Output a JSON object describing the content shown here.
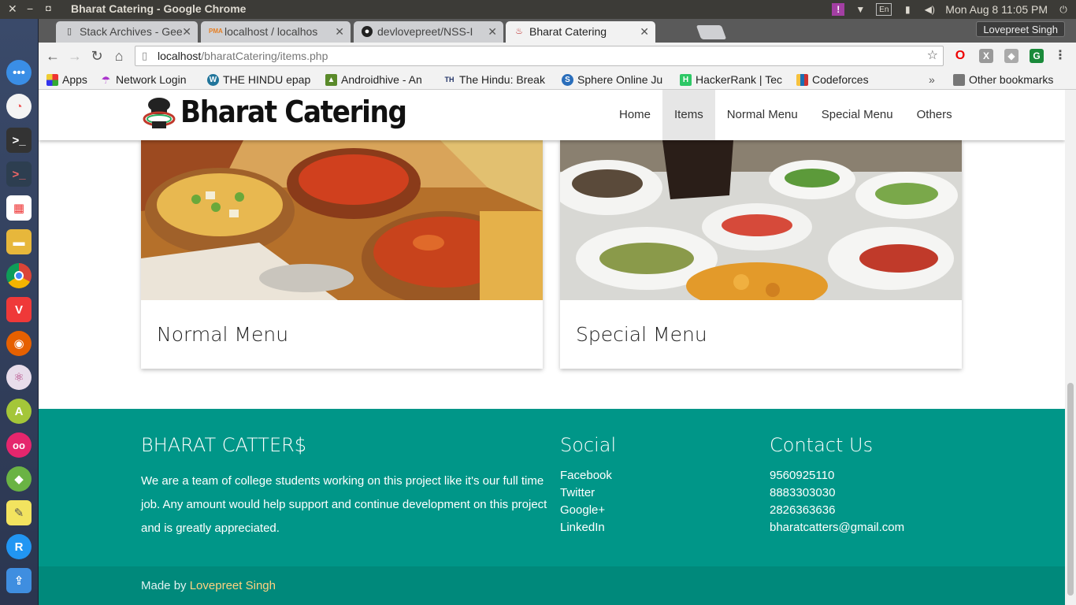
{
  "system": {
    "window_title": "Bharat Catering - Google Chrome",
    "keyboard_layout": "En",
    "clock": "Mon Aug  8 11:05 PM"
  },
  "launcher": {
    "apps": [
      "apple-logo-icon",
      "dash-icon",
      "pie-app-icon",
      "terminal-icon",
      "terminal-alt-icon",
      "apps-grid-icon",
      "files-icon",
      "chrome-icon",
      "vivaldi-icon",
      "firefox-icon",
      "atom-icon",
      "android-studio-icon",
      "flickr-icon",
      "android-app-icon",
      "notes-icon",
      "refresh-app-icon",
      "installer-icon"
    ]
  },
  "browser": {
    "tabs": [
      {
        "label": "Stack Archives - Gee",
        "icon": "document-icon",
        "active": false
      },
      {
        "label": "localhost / localhos",
        "icon": "pma-icon",
        "active": false
      },
      {
        "label": "devlovepreet/NSS-I",
        "icon": "github-icon",
        "active": false
      },
      {
        "label": "Bharat Catering",
        "icon": "chef-hat-icon",
        "active": true
      }
    ],
    "profile_name": "Lovepreet Singh",
    "url_host": "localhost",
    "url_path": "/bharatCatering/items.php",
    "bookmarks": [
      {
        "label": "Apps",
        "icon": "apps-icon"
      },
      {
        "label": "Network Login",
        "icon": "umbrella-icon"
      },
      {
        "label": "THE HINDU epap",
        "icon": "wordpress-icon"
      },
      {
        "label": "Androidhive - An",
        "icon": "androidhive-icon"
      },
      {
        "label": "The Hindu: Break",
        "icon": "th-icon"
      },
      {
        "label": "Sphere Online Ju",
        "icon": "spoj-icon"
      },
      {
        "label": "HackerRank | Tec",
        "icon": "hackerrank-icon"
      },
      {
        "label": "Codeforces",
        "icon": "codeforces-icon"
      }
    ],
    "bookmarks_overflow": "»",
    "other_bookmarks": "Other bookmarks"
  },
  "site": {
    "brand": "Bharat Catering",
    "nav": [
      {
        "label": "Home",
        "active": false
      },
      {
        "label": "Items",
        "active": true
      },
      {
        "label": "Normal Menu",
        "active": false
      },
      {
        "label": "Special Menu",
        "active": false
      },
      {
        "label": "Others",
        "active": false
      }
    ],
    "cards": [
      {
        "title": "Normal Menu"
      },
      {
        "title": "Special Menu"
      }
    ],
    "footer": {
      "about_heading": "BHARAT CATTER$",
      "about_text": "We are a team of college students working on this project like it's our full time job. Any amount would help support and continue development on this project and is greatly appreciated.",
      "social_heading": "Social",
      "social_links": [
        "Facebook",
        "Twitter",
        "Google+",
        "LinkedIn"
      ],
      "contact_heading": "Contact Us",
      "contacts": [
        "9560925110",
        "8883303030",
        "2826363636",
        "bharatcatters@gmail.com"
      ],
      "made_by_prefix": "Made by",
      "made_by_author": "Lovepreet Singh"
    },
    "colors": {
      "footer_bg": "#009688",
      "copyright_bg": "#00897b",
      "author_link": "#ffd180"
    }
  }
}
